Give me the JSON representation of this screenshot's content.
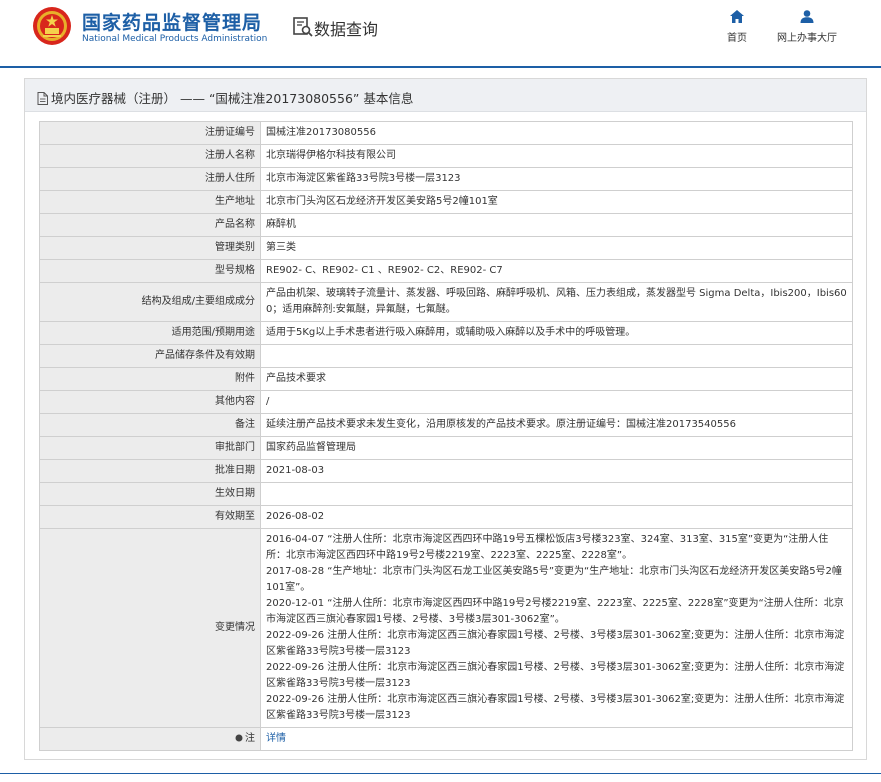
{
  "header": {
    "site_name": "国家药品监督管理局",
    "site_name_en": "National Medical Products Administration",
    "section_title": "数据查询",
    "nav": [
      {
        "label": "首页",
        "icon": "home-icon"
      },
      {
        "label": "网上办事大厅",
        "icon": "user-icon"
      }
    ]
  },
  "colors": {
    "brand": "#1d5fa6",
    "label_bg": "#ececec",
    "title_bar_bg": "#eef0f3"
  },
  "panel": {
    "title": "境内医疗器械（注册） —— “国械注准20173080556” 基本信息"
  },
  "fields": [
    {
      "label": "注册证编号",
      "value": "国械注准20173080556"
    },
    {
      "label": "注册人名称",
      "value": "北京瑞得伊格尔科技有限公司"
    },
    {
      "label": "注册人住所",
      "value": "北京市海淀区紫雀路33号院3号楼一层3123"
    },
    {
      "label": "生产地址",
      "value": "北京市门头沟区石龙经济开发区美安路5号2幢101室"
    },
    {
      "label": "产品名称",
      "value": "麻醉机"
    },
    {
      "label": "管理类别",
      "value": "第三类"
    },
    {
      "label": "型号规格",
      "value": "RE902- C、RE902- C1 、RE902- C2、RE902- C7"
    },
    {
      "label": "结构及组成/主要组成成分",
      "value": "产品由机架、玻璃转子流量计、蒸发器、呼吸回路、麻醉呼吸机、风箱、压力表组成，蒸发器型号 Sigma Delta，Ibis200，Ibis600；适用麻醉剂:安氟醚，异氟醚，七氟醚。"
    },
    {
      "label": "适用范围/预期用途",
      "value": "适用于5Kg以上手术患者进行吸入麻醉用，或辅助吸入麻醉以及手术中的呼吸管理。"
    },
    {
      "label": "产品储存条件及有效期",
      "value": ""
    },
    {
      "label": "附件",
      "value": "产品技术要求"
    },
    {
      "label": "其他内容",
      "value": "/"
    },
    {
      "label": "备注",
      "value": "延续注册产品技术要求未发生变化，沿用原核发的产品技术要求。原注册证编号：国械注准20173540556"
    },
    {
      "label": "审批部门",
      "value": "国家药品监督管理局"
    },
    {
      "label": "批准日期",
      "value": "2021-08-03"
    },
    {
      "label": "生效日期",
      "value": ""
    },
    {
      "label": "有效期至",
      "value": "2026-08-02"
    }
  ],
  "change_history": {
    "label": "变更情况",
    "entries": [
      "2016-04-07 “注册人住所：北京市海淀区西四环中路19号五棵松饭店3号楼323室、324室、313室、315室”变更为“注册人住所：北京市海淀区西四环中路19号2号楼2219室、2223室、2225室、2228室”。",
      "2017-08-28 “生产地址：北京市门头沟区石龙工业区美安路5号”变更为“生产地址：北京市门头沟区石龙经济开发区美安路5号2幢101室”。",
      "2020-12-01 “注册人住所：北京市海淀区西四环中路19号2号楼2219室、2223室、2225室、2228室”变更为“注册人住所：北京市海淀区西三旗沁春家园1号楼、2号楼、3号楼3层301-3062室”。",
      "2022-09-26 注册人住所：北京市海淀区西三旗沁春家园1号楼、2号楼、3号楼3层301-3062室;变更为：注册人住所：北京市海淀区紫雀路33号院3号楼一层3123",
      "2022-09-26 注册人住所：北京市海淀区西三旗沁春家园1号楼、2号楼、3号楼3层301-3062室;变更为：注册人住所：北京市海淀区紫雀路33号院3号楼一层3123",
      "2022-09-26 注册人住所：北京市海淀区西三旗沁春家园1号楼、2号楼、3号楼3层301-3062室;变更为：注册人住所：北京市海淀区紫雀路33号院3号楼一层3123"
    ]
  },
  "note": {
    "label": "注",
    "link_text": "详情",
    "icon": "info-icon"
  }
}
